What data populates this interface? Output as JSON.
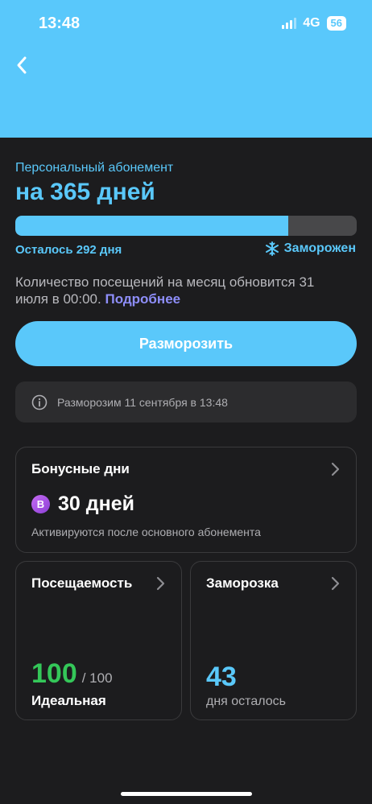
{
  "status_bar": {
    "time": "13:48",
    "network": "4G",
    "battery": "56"
  },
  "subscription": {
    "type_label": "Персональный абонемент",
    "duration_title": "на 365 дней",
    "progress_fraction": 0.8,
    "remaining_label": "Осталось 292 дня",
    "frozen_label": "Заморожен",
    "visits_info": "Количество посещений на месяц обновится 31 июля в 00:00.",
    "more_link": "Подробнее"
  },
  "actions": {
    "unfreeze_button": "Разморозить",
    "unfreeze_notice": "Разморозим 11 сентября в 13:48"
  },
  "bonus_card": {
    "title": "Бонусные дни",
    "badge_letter": "B",
    "value": "30 дней",
    "note": "Активируются после основного абонемента"
  },
  "attendance_card": {
    "title": "Посещаемость",
    "score": "100",
    "max": "/ 100",
    "label": "Идеальная"
  },
  "freeze_card": {
    "title": "Заморозка",
    "value": "43",
    "label": "дня осталось"
  },
  "colors": {
    "header_bg": "#59c8fb",
    "accent": "#5ac8fa",
    "success": "#34c759",
    "link": "#8e8efa",
    "background": "#1c1c1e"
  }
}
